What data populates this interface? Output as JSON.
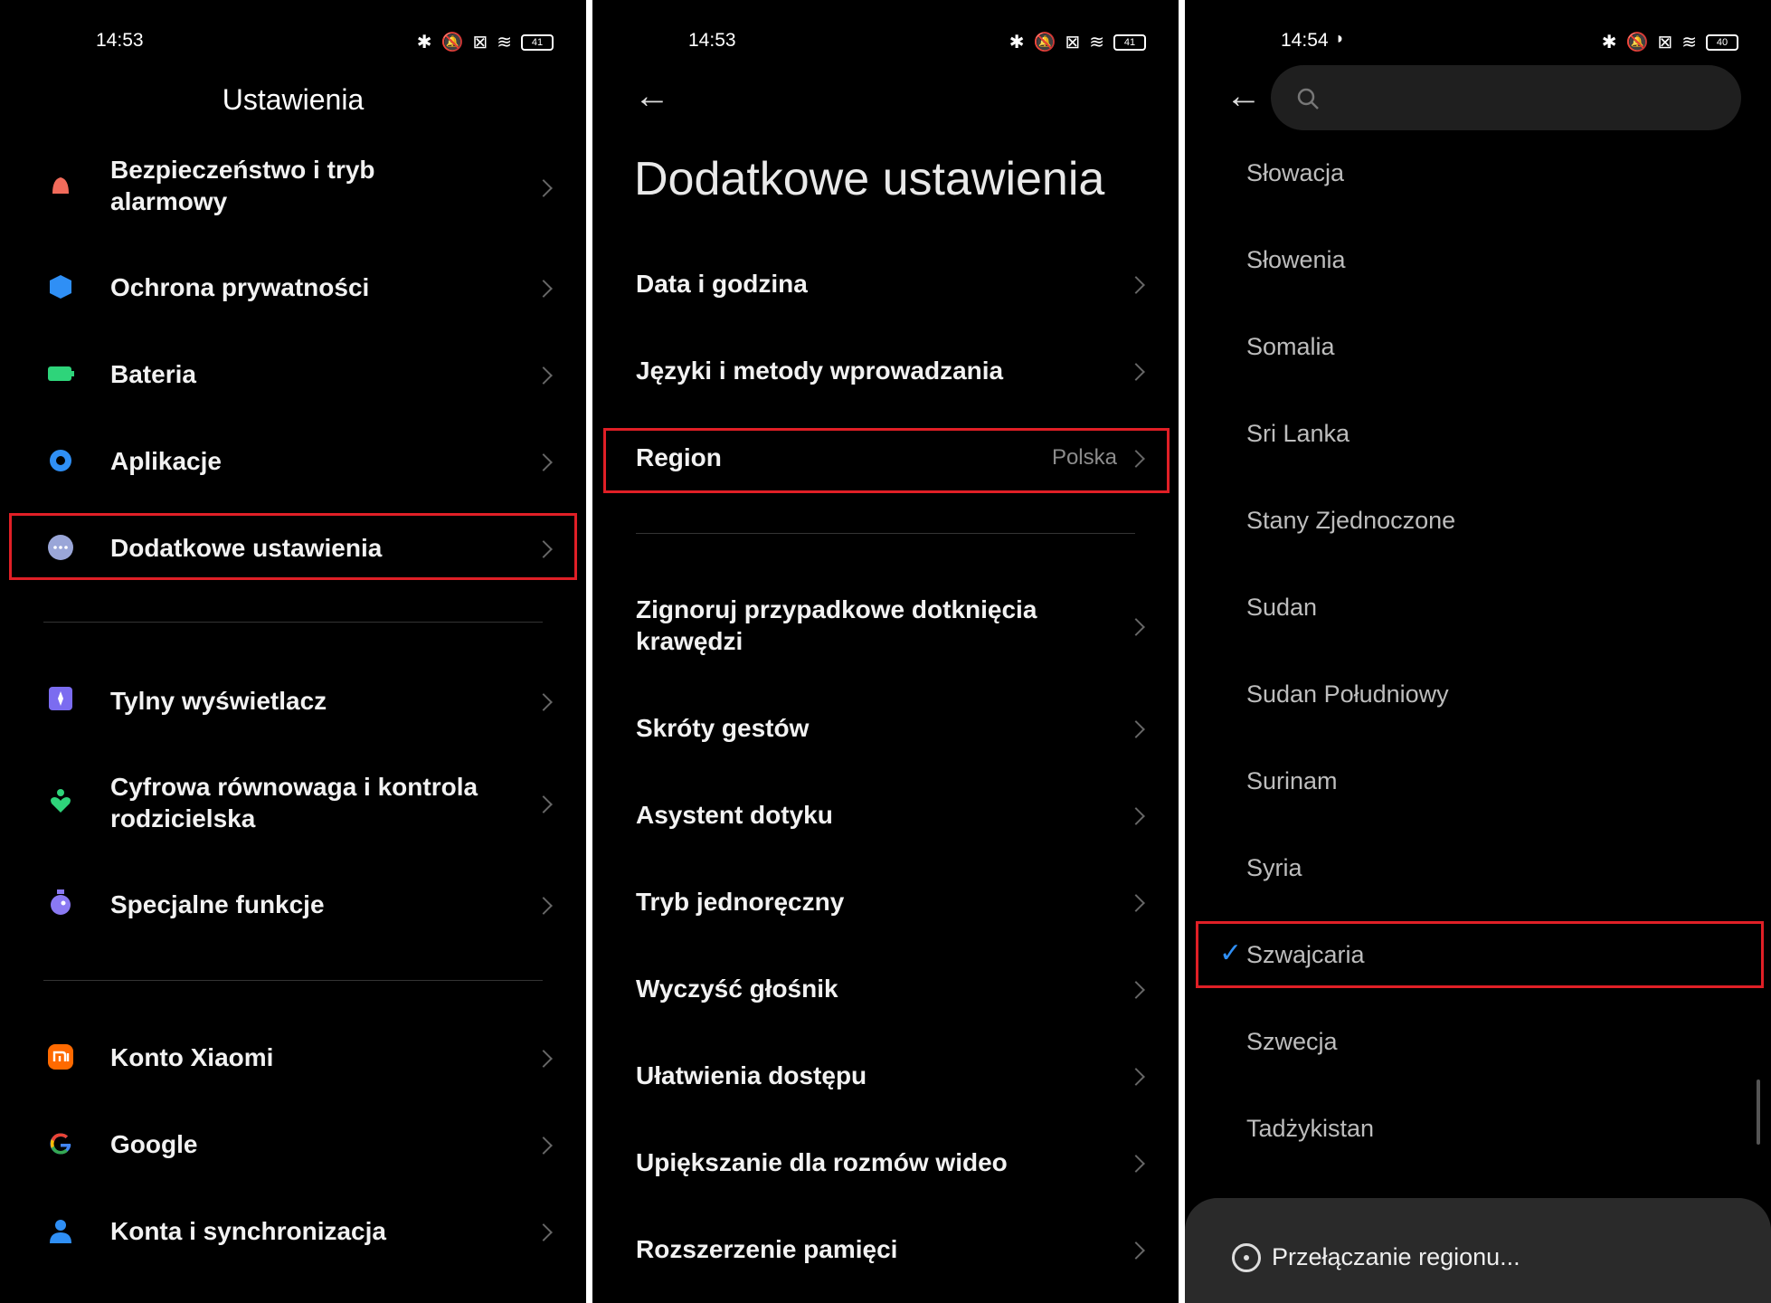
{
  "panel1": {
    "time": "14:53",
    "battery": "41",
    "title": "Ustawienia",
    "items": [
      {
        "label": "Bezpieczeństwo i tryb alarmowy",
        "icon": "alarm-bell-icon",
        "color": "#f26b5b"
      },
      {
        "label": "Ochrona prywatności",
        "icon": "privacy-shield-icon",
        "color": "#2f8ff5"
      },
      {
        "label": "Bateria",
        "icon": "battery-icon",
        "color": "#2ed47a"
      },
      {
        "label": "Aplikacje",
        "icon": "apps-gear-icon",
        "color": "#2f8ff5"
      },
      {
        "label": "Dodatkowe ustawienia",
        "icon": "more-dots-icon",
        "color": "#9aa6d8"
      },
      {
        "label": "Tylny wyświetlacz",
        "icon": "rear-display-icon",
        "color": "#7b6cf0"
      },
      {
        "label": "Cyfrowa równowaga i kontrola rodzicielska",
        "icon": "wellbeing-heart-icon",
        "color": "#2ed47a"
      },
      {
        "label": "Specjalne funkcje",
        "icon": "special-features-icon",
        "color": "#8a79f3"
      },
      {
        "label": "Konto Xiaomi",
        "icon": "xiaomi-logo-icon",
        "color": "#ff6a00"
      },
      {
        "label": "Google",
        "icon": "google-g-icon",
        "color": "#4285f4"
      },
      {
        "label": "Konta i synchronizacja",
        "icon": "user-account-icon",
        "color": "#2f8ff5"
      }
    ]
  },
  "panel2": {
    "time": "14:53",
    "battery": "41",
    "title": "Dodatkowe ustawienia",
    "items": [
      {
        "label": "Data i godzina"
      },
      {
        "label": "Języki i metody wprowadzania"
      },
      {
        "label": "Region",
        "value": "Polska"
      },
      {
        "label": "Zignoruj przypadkowe dotknięcia krawędzi"
      },
      {
        "label": "Skróty gestów"
      },
      {
        "label": "Asystent dotyku"
      },
      {
        "label": "Tryb jednoręczny"
      },
      {
        "label": "Wyczyść głośnik"
      },
      {
        "label": "Ułatwienia dostępu"
      },
      {
        "label": "Upiększanie dla rozmów wideo"
      },
      {
        "label": "Rozszerzenie pamięci"
      }
    ]
  },
  "panel3": {
    "time": "14:54",
    "battery": "40",
    "search_placeholder": "",
    "countries": [
      "Słowacja",
      "Słowenia",
      "Somalia",
      "Sri Lanka",
      "Stany Zjednoczone",
      "Sudan",
      "Sudan Południowy",
      "Surinam",
      "Syria",
      "Szwajcaria",
      "Szwecja",
      "Tadżykistan"
    ],
    "selected": "Szwajcaria",
    "accent": "#2f8ff5",
    "toast": "Przełączanie regionu..."
  },
  "highlight_color": "#e01f26"
}
